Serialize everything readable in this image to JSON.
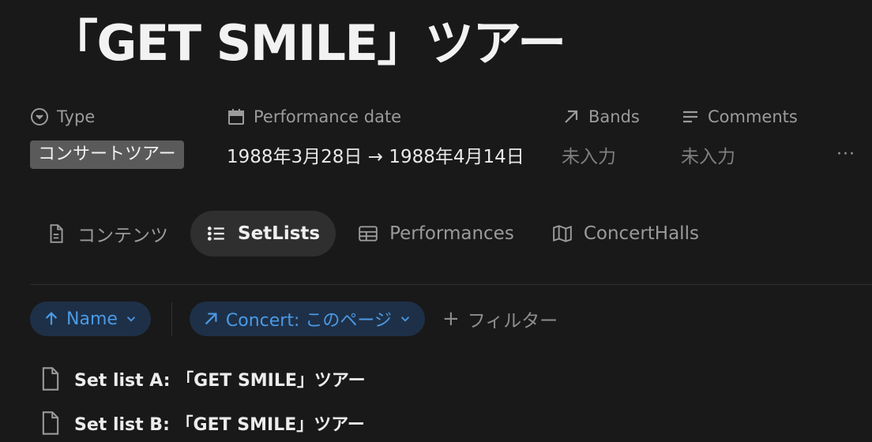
{
  "page": {
    "title": "「GET SMILE」ツアー"
  },
  "properties": [
    {
      "name": "Type",
      "icon": "chevron-circle-icon",
      "value": "コンサートツアー",
      "value_kind": "tag"
    },
    {
      "name": "Performance date",
      "icon": "calendar-icon",
      "value": "1988年3月28日 → 1988年4月14日",
      "value_kind": "text"
    },
    {
      "name": "Bands",
      "icon": "arrow-up-right-icon",
      "value": "未入力",
      "value_kind": "empty"
    },
    {
      "name": "Comments",
      "icon": "lines-icon",
      "value": "未入力",
      "value_kind": "empty"
    }
  ],
  "more_label": "···",
  "tabs": [
    {
      "label": "コンテンツ",
      "icon": "document-icon",
      "active": false
    },
    {
      "label": "SetLists",
      "icon": "list-icon",
      "active": true
    },
    {
      "label": "Performances",
      "icon": "table-icon",
      "active": false
    },
    {
      "label": "ConcertHalls",
      "icon": "map-icon",
      "active": false
    }
  ],
  "filters": {
    "sort": {
      "label": "Name",
      "icon": "arrow-up-icon"
    },
    "relation": {
      "label": "Concert: このページ",
      "icon": "arrow-up-right-icon"
    },
    "add_label": "フィルター"
  },
  "rows": [
    {
      "label": "Set list A: 「GET SMILE」ツアー"
    },
    {
      "label": "Set list B: 「GET SMILE」ツアー"
    }
  ],
  "colors": {
    "background": "#191919",
    "chip_bg": "#1e3047",
    "chip_text": "#4a9ae6",
    "tag_bg": "#5a5a5a"
  }
}
